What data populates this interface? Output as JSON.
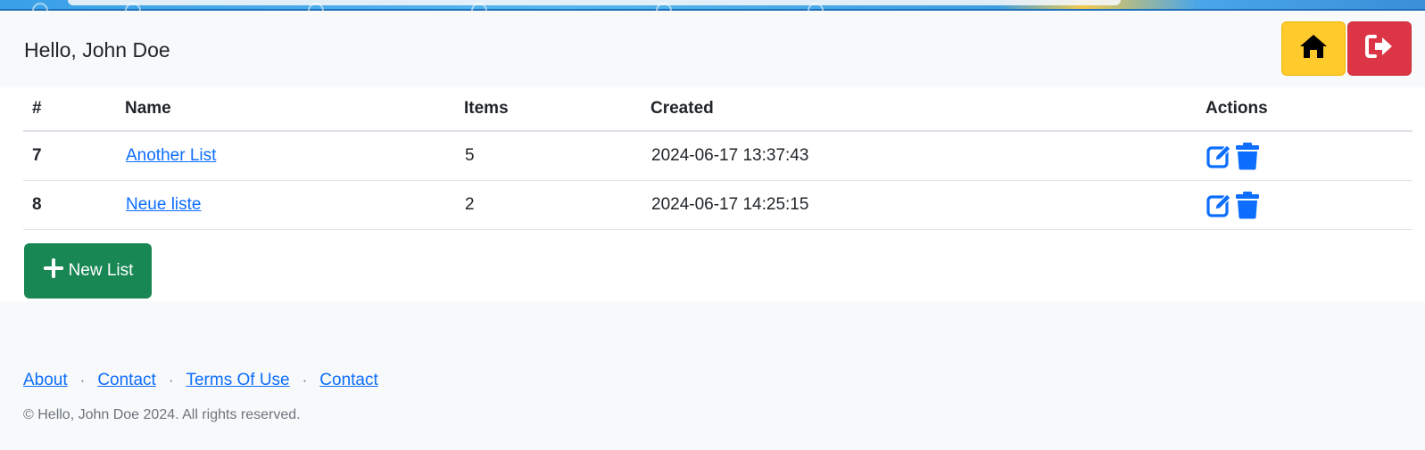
{
  "header": {
    "greeting": "Hello, John Doe",
    "home_button_icon": "home-icon",
    "logout_button_icon": "sign-out-icon",
    "home_button_color": "#ffca2c",
    "logout_button_color": "#dc3545"
  },
  "table": {
    "columns": [
      "#",
      "Name",
      "Items",
      "Created",
      "Actions"
    ],
    "rows": [
      {
        "id": "7",
        "name": "Another List",
        "items": "5",
        "created": "2024-06-17 13:37:43",
        "actions": [
          "edit-icon",
          "trash-icon"
        ]
      },
      {
        "id": "8",
        "name": "Neue liste",
        "items": "2",
        "created": "2024-06-17 14:25:15",
        "actions": [
          "edit-icon",
          "trash-icon"
        ]
      }
    ]
  },
  "new_list_button": {
    "label": "New List",
    "icon": "plus-icon",
    "color": "#198754"
  },
  "footer": {
    "links": [
      "About",
      "Contact",
      "Terms Of Use",
      "Contact"
    ],
    "separator": "·",
    "copyright": "© Hello, John Doe 2024. All rights reserved."
  },
  "colors": {
    "link": "#0d6efd",
    "background": "#f8f9fa"
  }
}
